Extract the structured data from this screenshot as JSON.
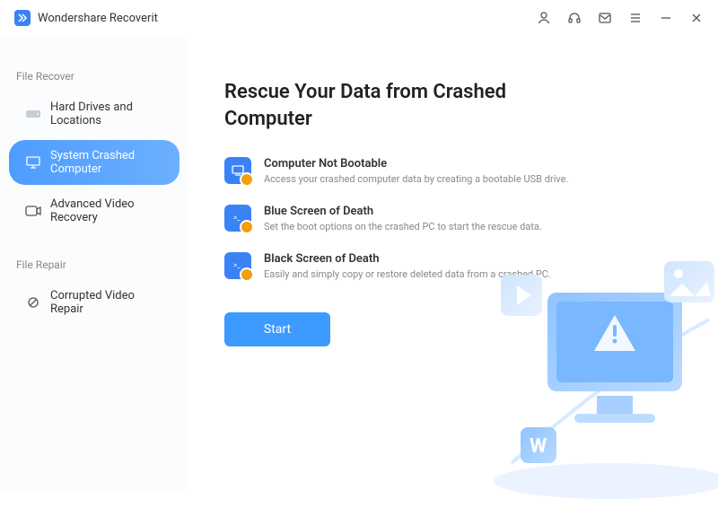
{
  "app": {
    "title": "Wondershare Recoverit"
  },
  "titlebar": {
    "icons": [
      "user",
      "headset",
      "mail",
      "menu",
      "minimize",
      "close"
    ]
  },
  "sidebar": {
    "sections": [
      {
        "label": "File Recover",
        "items": [
          {
            "label": "Hard Drives and Locations",
            "icon": "drive",
            "active": false
          },
          {
            "label": "System Crashed Computer",
            "icon": "monitor",
            "active": true
          },
          {
            "label": "Advanced Video Recovery",
            "icon": "video",
            "active": false
          }
        ]
      },
      {
        "label": "File Repair",
        "items": [
          {
            "label": "Corrupted Video Repair",
            "icon": "wrench",
            "active": false
          }
        ]
      }
    ]
  },
  "main": {
    "title": "Rescue Your Data from Crashed Computer",
    "features": [
      {
        "title": "Computer Not Bootable",
        "desc": "Access your crashed computer data by creating a bootable USB drive."
      },
      {
        "title": "Blue Screen of Death",
        "desc": "Set the boot options on the crashed PC to start the rescue data."
      },
      {
        "title": "Black Screen of Death",
        "desc": "Easily and simply copy or restore deleted data from a crashed PC."
      }
    ],
    "start_label": "Start"
  }
}
